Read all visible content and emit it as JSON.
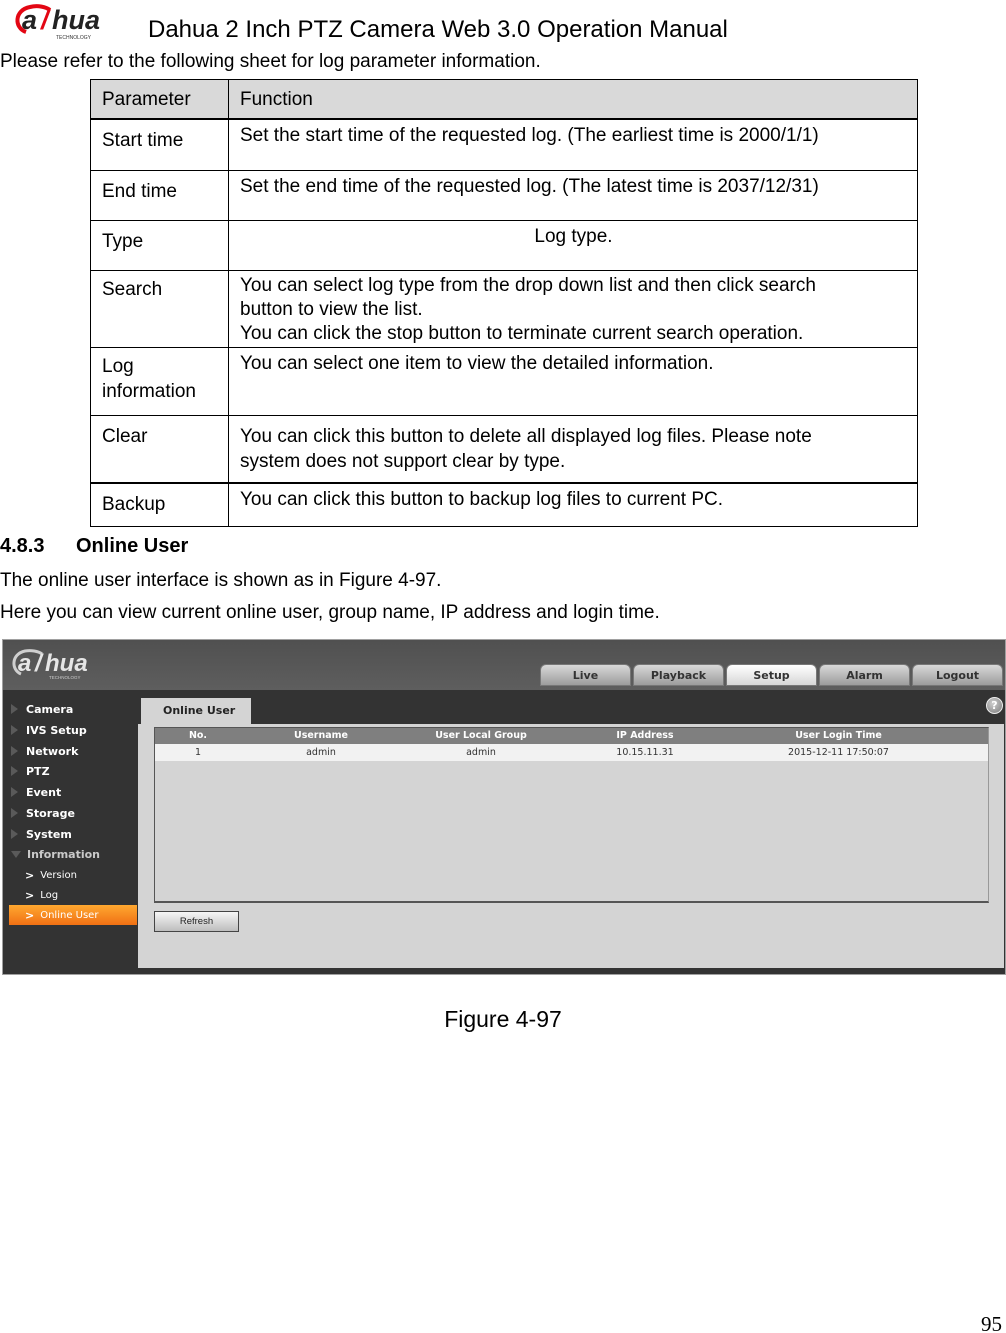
{
  "header": {
    "brand": "alhua",
    "brand_sub": "TECHNOLOGY",
    "title": "Dahua 2 Inch PTZ Camera Web 3.0 Operation Manual",
    "brand_color": "#e30613"
  },
  "intro": "Please refer to the following sheet for log parameter information.",
  "param_table": {
    "headers": [
      "Parameter",
      "Function"
    ],
    "rows": [
      {
        "param": "Start time",
        "function": "Set the start time of the requested log. (The earliest time is 2000/1/1)"
      },
      {
        "param": "End time",
        "function": "Set the end time of the requested log. (The latest time is 2037/12/31)"
      },
      {
        "param": "Type",
        "function": "Log type."
      },
      {
        "param": "Search",
        "function_lines": [
          "You can select log type from the drop down list and then click search",
          "button to view the list.",
          "You can click the stop button to terminate current search operation."
        ]
      },
      {
        "param_lines": [
          "Log",
          "information"
        ],
        "function": "You can select one item to view the detailed information."
      },
      {
        "param": "Clear",
        "function_lines": [
          "You can click this button to delete all displayed log files.  Please note",
          "system does not support clear by type."
        ]
      },
      {
        "param": "Backup",
        "function": "You can click this button to backup log files to current PC."
      }
    ]
  },
  "section": {
    "number": "4.8.3",
    "title": "Online User",
    "para1": "The online user interface is shown as in Figure 4-97.",
    "para2": "Here you can view current online user, group name, IP address and login time."
  },
  "app": {
    "brand": "alhua",
    "brand_sub": "TECHNOLOGY",
    "top_tabs": [
      {
        "label": "Live",
        "active": false
      },
      {
        "label": "Playback",
        "active": false
      },
      {
        "label": "Setup",
        "active": true
      },
      {
        "label": "Alarm",
        "active": false
      },
      {
        "label": "Logout",
        "active": false
      }
    ],
    "sidebar": {
      "items": [
        "Camera",
        "IVS Setup",
        "Network",
        "PTZ",
        "Event",
        "Storage",
        "System"
      ],
      "expanded": "Information",
      "sub_items": [
        "Version",
        "Log",
        "Online User"
      ],
      "active_sub": "Online User",
      "accent_color": "#f58220"
    },
    "content_tab": "Online User",
    "help_icon": "?",
    "table": {
      "columns": [
        "No.",
        "Username",
        "User Local Group",
        "IP Address",
        "User Login Time"
      ],
      "rows": [
        [
          "1",
          "admin",
          "admin",
          "10.15.11.31",
          "2015-12-11 17:50:07"
        ]
      ]
    },
    "refresh_label": "Refresh"
  },
  "caption": "Figure 4-97",
  "page_number": "95"
}
